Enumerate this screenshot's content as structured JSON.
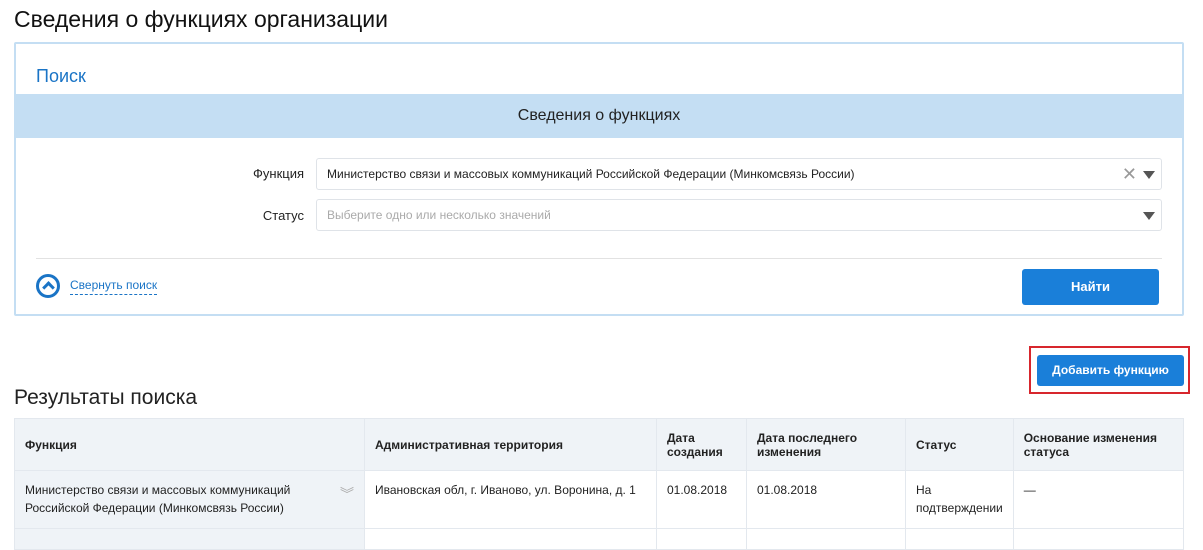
{
  "page_title": "Сведения о функциях организации",
  "search": {
    "heading": "Поиск",
    "band": "Сведения о функциях",
    "function_label": "Функция",
    "function_value": "Министерство связи и массовых коммуникаций Российской Федерации (Минкомсвязь России)",
    "status_label": "Статус",
    "status_placeholder": "Выберите одно или несколько значений",
    "collapse": "Свернуть поиск",
    "find": "Найти",
    "clear": "✕"
  },
  "add_button": "Добавить функцию",
  "results": {
    "title": "Результаты поиска",
    "columns": [
      "Функция",
      "Административная территория",
      "Дата создания",
      "Дата последнего изменения",
      "Статус",
      "Основание изменения статуса"
    ],
    "rows": [
      [
        "Министерство связи и массовых коммуникаций Российской Федерации (Минкомсвязь России)",
        "Ивановская обл, г. Иваново, ул. Воронина, д. 1",
        "01.08.2018",
        "01.08.2018",
        "На подтверждении",
        "—"
      ]
    ]
  }
}
